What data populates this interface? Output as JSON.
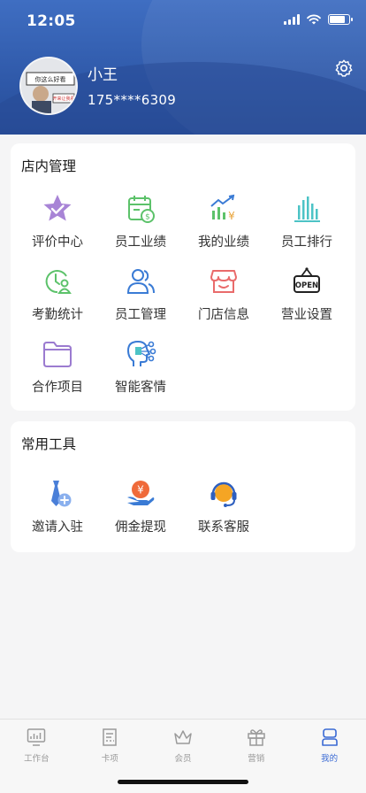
{
  "status_bar": {
    "time": "12:05"
  },
  "profile": {
    "name": "小王",
    "phone": "175****6309",
    "avatar_caption_1": "你这么好看",
    "avatar_caption_2": "开来让我看"
  },
  "store_section": {
    "title": "店内管理",
    "items": [
      {
        "label": "评价中心",
        "icon": "star-check-icon"
      },
      {
        "label": "员工业绩",
        "icon": "calendar-money-icon"
      },
      {
        "label": "我的业绩",
        "icon": "chart-yen-icon"
      },
      {
        "label": "员工排行",
        "icon": "bar-chart-icon"
      },
      {
        "label": "考勤统计",
        "icon": "clock-person-icon"
      },
      {
        "label": "员工管理",
        "icon": "people-icon"
      },
      {
        "label": "门店信息",
        "icon": "store-icon"
      },
      {
        "label": "营业设置",
        "icon": "open-sign-icon"
      },
      {
        "label": "合作项目",
        "icon": "folder-icon"
      },
      {
        "label": "智能客情",
        "icon": "ai-head-icon"
      }
    ]
  },
  "tools_section": {
    "title": "常用工具",
    "items": [
      {
        "label": "邀请入驻",
        "icon": "invite-icon"
      },
      {
        "label": "佣金提现",
        "icon": "yen-hand-icon"
      },
      {
        "label": "联系客服",
        "icon": "headset-icon"
      }
    ]
  },
  "tabbar": {
    "items": [
      {
        "label": "工作台",
        "icon": "dashboard-icon"
      },
      {
        "label": "卡项",
        "icon": "card-icon"
      },
      {
        "label": "会员",
        "icon": "crown-icon"
      },
      {
        "label": "营销",
        "icon": "gift-icon"
      },
      {
        "label": "我的",
        "icon": "person-icon",
        "active": true
      }
    ]
  },
  "colors": {
    "header": "#3f6ec2",
    "active_tab": "#3a6ad4",
    "purple": "#9b7bd0",
    "green": "#5cc26a",
    "red": "#e96b6b",
    "orange": "#f59a2e"
  }
}
